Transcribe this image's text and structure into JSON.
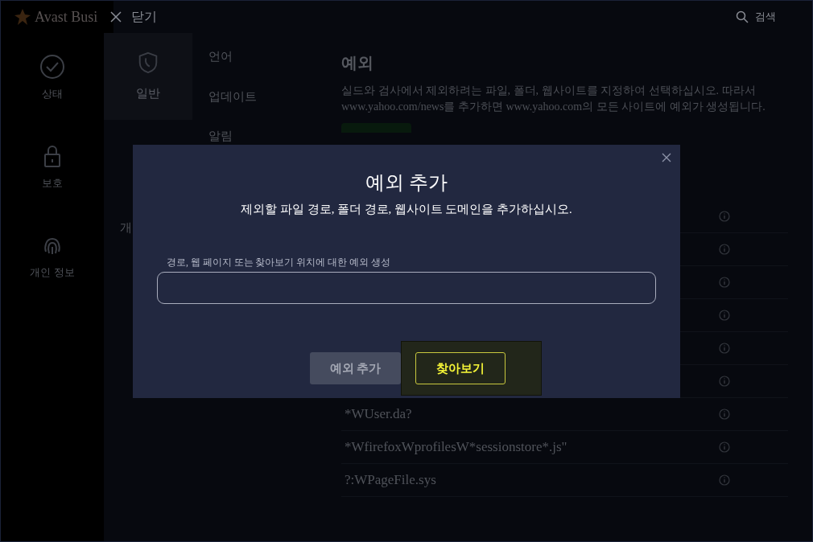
{
  "header": {
    "brand": "Avast Busi",
    "close_label": "닫기",
    "search_label": "검색"
  },
  "nav": [
    {
      "label": "상태",
      "selected": false
    },
    {
      "label": "보호",
      "selected": false
    },
    {
      "label": "개인 정보",
      "selected": false
    }
  ],
  "settings_tabs": [
    {
      "label": "일반",
      "selected": true
    },
    {
      "label": "개",
      "selected": false
    }
  ],
  "menu": [
    "언어",
    "업데이트",
    "알림"
  ],
  "section": {
    "title": "예외",
    "description": "실드와 검사에서 제외하려는 파일, 폴더, 웹사이트를 지정하여 선택하십시오. 따라서 www.yahoo.com/news를 추가하면 www.yahoo.com의 모든 사이트에 예외가 생성됩니다."
  },
  "exceptions": [
    {
      "text": "*WUser.da?"
    },
    {
      "text": "*WfirefoxWprofilesW*sessionstore*.js\""
    },
    {
      "text": "?:WPageFile.sys"
    }
  ],
  "modal": {
    "title": "예외 추가",
    "subtitle": "제외할 파일 경로, 폴더 경로, 웹사이트 도메인을 추가하십시오.",
    "field_label": "경로, 웹 페이지 또는 찾아보기 위치에 대한 예외 생성",
    "buttons": [
      {
        "label": "예외 추가",
        "disabled": true,
        "focused": false
      },
      {
        "label": "찾아보기",
        "disabled": false,
        "focused": true
      }
    ]
  }
}
